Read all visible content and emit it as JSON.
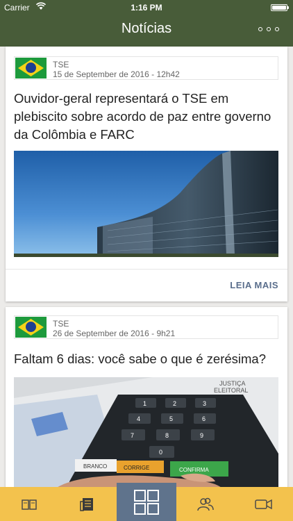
{
  "status_bar": {
    "carrier": "Carrier",
    "time": "1:16 PM"
  },
  "nav": {
    "title": "Notícias",
    "more_icon": "more-icon"
  },
  "articles": [
    {
      "source": "TSE",
      "date": "15 de September de 2016 - 12h42",
      "title": "Ouvidor-geral representará o TSE em plebiscito sobre acordo de paz entre governo da Colômbia e FARC",
      "read_more": "LEIA MAIS"
    },
    {
      "source": "TSE",
      "date": "26 de September de 2016 - 9h21",
      "title": "Faltam 6 dias: você sabe o que é zerésima?",
      "machine_header_1": "JUSTIÇA",
      "machine_header_2": "ELEITORAL",
      "key_branco": "BRANCO",
      "key_corrige": "CORRIGE",
      "key_confirma": "CONFIRMA"
    }
  ],
  "tabbar": {
    "items": [
      "magazine-icon",
      "newspaper-icon",
      "grid-icon",
      "people-icon",
      "video-camera-icon"
    ],
    "active_index": 2
  },
  "colors": {
    "nav": "#485c39",
    "tabbar": "#f3c24d",
    "active_tab": "#5f738c",
    "link": "#5a6e8c"
  }
}
